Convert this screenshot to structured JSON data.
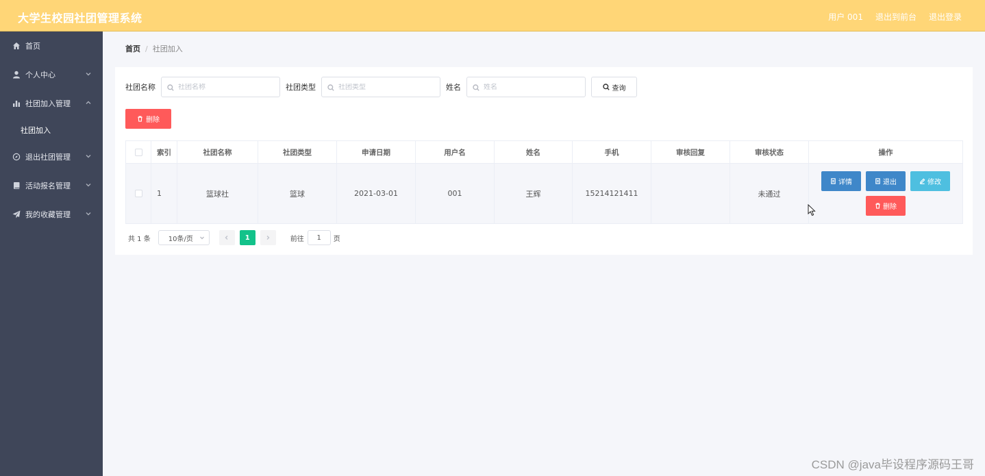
{
  "header": {
    "title": "大学生校园社团管理系统",
    "user": "用户 001",
    "to_front": "退出到前台",
    "logout": "退出登录",
    "background": "#ffd677"
  },
  "sidebar": {
    "items": [
      {
        "label": "首页",
        "icon": "home-icon"
      },
      {
        "label": "个人中心",
        "icon": "user-icon",
        "chevron": "chevron-down"
      },
      {
        "label": "社团加入管理",
        "icon": "bar-chart-icon",
        "chevron": "chevron-up",
        "expanded": true
      },
      {
        "label": "退出社团管理",
        "icon": "compass-icon",
        "chevron": "chevron-down"
      },
      {
        "label": "活动报名管理",
        "icon": "book-icon",
        "chevron": "chevron-down"
      },
      {
        "label": "我的收藏管理",
        "icon": "send-icon",
        "chevron": "chevron-down"
      }
    ],
    "submenu": [
      {
        "label": "社团加入",
        "parent": "社团加入管理"
      }
    ],
    "background": "#3f4659"
  },
  "breadcrumb": {
    "home": "首页",
    "separator": "/",
    "current": "社团加入"
  },
  "search": {
    "fields": [
      {
        "label": "社团名称",
        "placeholder": "社团名称",
        "value": ""
      },
      {
        "label": "社团类型",
        "placeholder": "社团类型",
        "value": ""
      },
      {
        "label": "姓名",
        "placeholder": "姓名",
        "value": ""
      }
    ],
    "query_label": "查询"
  },
  "toolbar": {
    "delete_label": "删除",
    "delete_color": "#ff5a5a"
  },
  "table": {
    "columns": [
      "索引",
      "社团名称",
      "社团类型",
      "申请日期",
      "用户名",
      "姓名",
      "手机",
      "审核回复",
      "审核状态",
      "操作"
    ],
    "rows": [
      {
        "index": "1",
        "club_name": "篮球社",
        "club_type": "篮球",
        "apply_date": "2021-03-01",
        "username": "001",
        "name": "王辉",
        "phone": "15214121411",
        "review_reply": "",
        "review_status": "未通过",
        "actions": {
          "detail": "详情",
          "exit": "退出",
          "edit": "修改",
          "delete": "删除"
        }
      }
    ]
  },
  "pagination": {
    "total": "共 1 条",
    "page_size": "10条/页",
    "current_page": "1",
    "goto_label": "前往",
    "goto_value": "1",
    "page_suffix": "页",
    "active_color": "#13c28a"
  },
  "watermark": "CSDN @java毕设程序源码王哥"
}
